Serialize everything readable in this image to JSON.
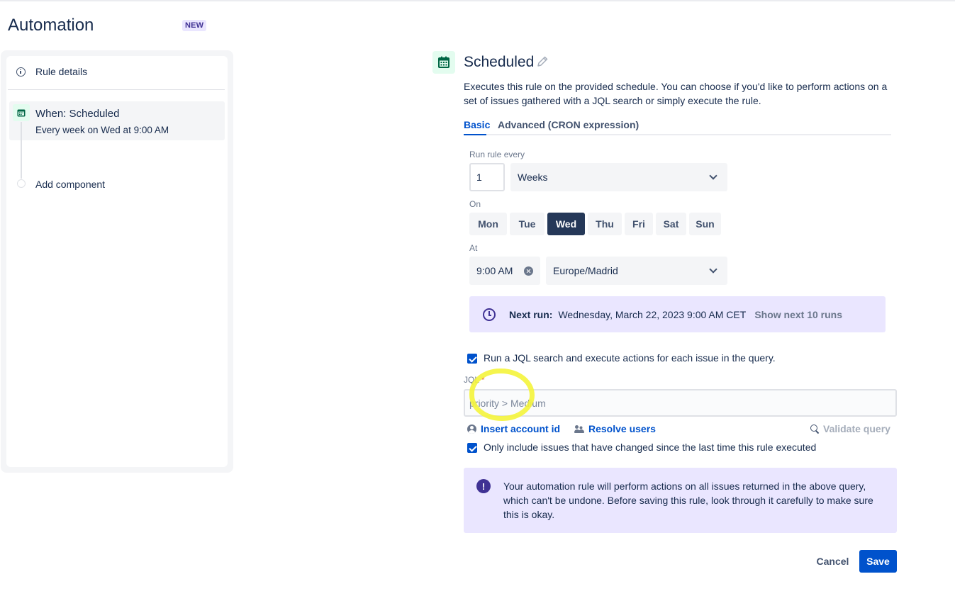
{
  "app": {
    "title": "Automation",
    "badge": "NEW"
  },
  "sidebar": {
    "rule_details": "Rule details",
    "trigger": {
      "title": "When: Scheduled",
      "subtitle": "Every week on Wed at 9:00 AM"
    },
    "add_component": "Add component"
  },
  "editor": {
    "title": "Scheduled",
    "description": "Executes this rule on the provided schedule. You can choose if you'd like to perform actions on a set of issues gathered with a JQL search or simply execute the rule.",
    "tabs": [
      {
        "label": "Basic",
        "active": true
      },
      {
        "label": "Advanced (CRON expression)",
        "active": false
      }
    ],
    "run_every": {
      "label": "Run rule every",
      "value": "1",
      "unit": "Weeks"
    },
    "on": {
      "label": "On",
      "days": [
        "Mon",
        "Tue",
        "Wed",
        "Thu",
        "Fri",
        "Sat",
        "Sun"
      ],
      "selected": "Wed"
    },
    "at": {
      "label": "At",
      "time": "9:00 AM",
      "timezone": "Europe/Madrid"
    },
    "next_run": {
      "label": "Next run:",
      "value": "Wednesday, March 22, 2023 9:00 AM CET",
      "link": "Show next 10 runs"
    },
    "jql_checkbox": {
      "label": "Run a JQL search and execute actions for each issue in the query.",
      "checked": true
    },
    "jql": {
      "label": "JQL",
      "required_mark": "*",
      "value": "priority > Medium"
    },
    "links": {
      "insert_account": "Insert account id",
      "resolve_users": "Resolve users",
      "validate": "Validate query"
    },
    "changed_checkbox": {
      "label": "Only include issues that have changed since the last time this rule executed",
      "checked": true
    },
    "warning": "Your automation rule will perform actions on all issues returned in the above query, which can't be undone. Before saving this rule, look through it carefully to make sure this is okay.",
    "actions": {
      "cancel": "Cancel",
      "save": "Save"
    }
  },
  "colors": {
    "primary": "#0052cc",
    "text": "#172b4d",
    "info_bg": "#eae6ff",
    "selected_day": "#253858",
    "highlight": "#f4f43b"
  }
}
